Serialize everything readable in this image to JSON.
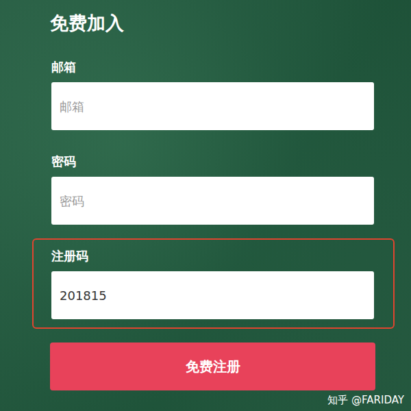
{
  "title": "免费加入",
  "fields": [
    {
      "label": "邮箱",
      "placeholder": "邮箱",
      "highlighted": false
    },
    {
      "label": "密码",
      "placeholder": "密码",
      "highlighted": false
    },
    {
      "label": "注册码",
      "value": "201815",
      "highlighted": true
    }
  ],
  "button": "免费注册",
  "watermark": "知乎 @FARIDAY"
}
